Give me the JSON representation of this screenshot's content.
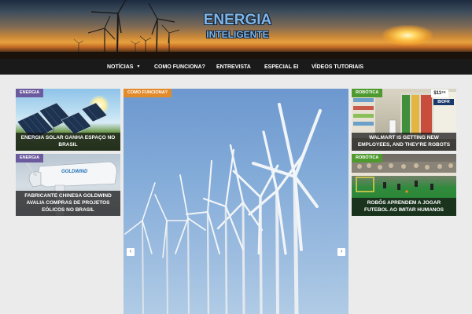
{
  "header": {
    "logo_line1": "ENERGIA",
    "logo_line2": "INTELIGENTE"
  },
  "nav": {
    "items": [
      {
        "label": "NOTÍCIAS",
        "has_dropdown": true
      },
      {
        "label": "COMO FUNCIONA?"
      },
      {
        "label": "ENTREVISTA"
      },
      {
        "label": "ESPECIAL EI"
      },
      {
        "label": "VÍDEOS TUTORIAIS"
      }
    ]
  },
  "left_tiles": [
    {
      "category": "ENERGIA",
      "title": "ENERGIA SOLAR GANHA ESPAÇO NO BRASIL"
    },
    {
      "category": "ENERGIA",
      "title": "FABRICANTE CHINESA GOLDWIND AVALIA COMPRAS DE PROJETOS EÓLICOS NO BRASIL",
      "brand": "GOLDWIND"
    }
  ],
  "main_slider": {
    "category": "COMO FUNCIONA?",
    "prev_icon": "chevron-left-icon",
    "next_icon": "chevron-right-icon"
  },
  "right_tiles": [
    {
      "category": "ROBÓTICA",
      "title": "WALMART IS GETTING NEW EMPLOYEES, AND THEY'RE ROBOTS",
      "price_sign": "$11⁹⁸",
      "store_sign": "BIOFR"
    },
    {
      "category": "ROBÓTICA",
      "title": "ROBÔS APRENDEM A JOGAR FUTEBOL AO IMITAR HUMANOS"
    }
  ],
  "colors": {
    "nav_bg": "#1a1a1a",
    "tag_purple": "#6b5a9e",
    "tag_orange": "#e28b2c",
    "tag_green": "#4f9a2e",
    "page_bg": "#ebebeb"
  }
}
